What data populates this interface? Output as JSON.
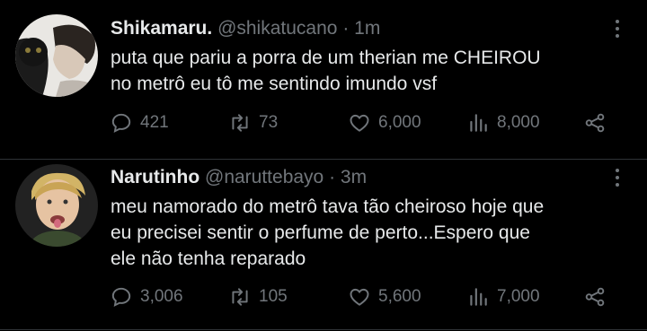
{
  "tweets": [
    {
      "name": "Shikamaru.",
      "handle": "@shikatucano",
      "dot": "·",
      "time": "1m",
      "text_lines": [
        "puta que pariu a porra de um therian me CHEIROU",
        "no metrô eu tô me sentindo imundo vsf"
      ],
      "stats": {
        "replies": "421",
        "retweets": "73",
        "likes": "6,000",
        "views": "8,000"
      }
    },
    {
      "name": "Narutinho",
      "handle": "@naruttebayo",
      "dot": "·",
      "time": "3m",
      "text_lines": [
        "meu namorado do metrô tava tão cheiroso hoje que",
        "eu precisei sentir o perfume de perto...Espero que",
        "ele não tenha reparado"
      ],
      "stats": {
        "replies": "3,006",
        "retweets": "105",
        "likes": "5,600",
        "views": "7,000"
      }
    }
  ],
  "icons": {
    "reply": "reply-icon",
    "retweet": "retweet-icon",
    "like": "heart-icon",
    "views": "views-icon",
    "share": "share-icon",
    "more": "more-icon"
  },
  "colors": {
    "background": "#000000",
    "text": "#e7e9ea",
    "secondary": "#71767b",
    "divider": "#2f3336"
  }
}
